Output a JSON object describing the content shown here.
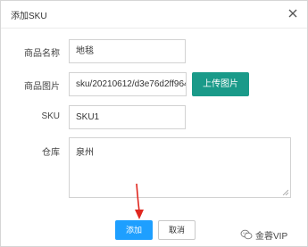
{
  "dialog": {
    "title": "添加SKU"
  },
  "form": {
    "name": {
      "label": "商品名称",
      "value": "地毯"
    },
    "image": {
      "label": "商品图片",
      "value": "sku/20210612/d3e76d2ff964",
      "upload_label": "上传图片"
    },
    "sku": {
      "label": "SKU",
      "value": "SKU1"
    },
    "warehouse": {
      "label": "仓库",
      "value": "泉州"
    }
  },
  "footer": {
    "add_label": "添加",
    "cancel_label": "取消"
  },
  "watermark": {
    "text": "金蓉VIP"
  },
  "colors": {
    "upload_button": "#1a9a89",
    "add_button": "#1e9fff",
    "arrow": "#e0271f"
  }
}
